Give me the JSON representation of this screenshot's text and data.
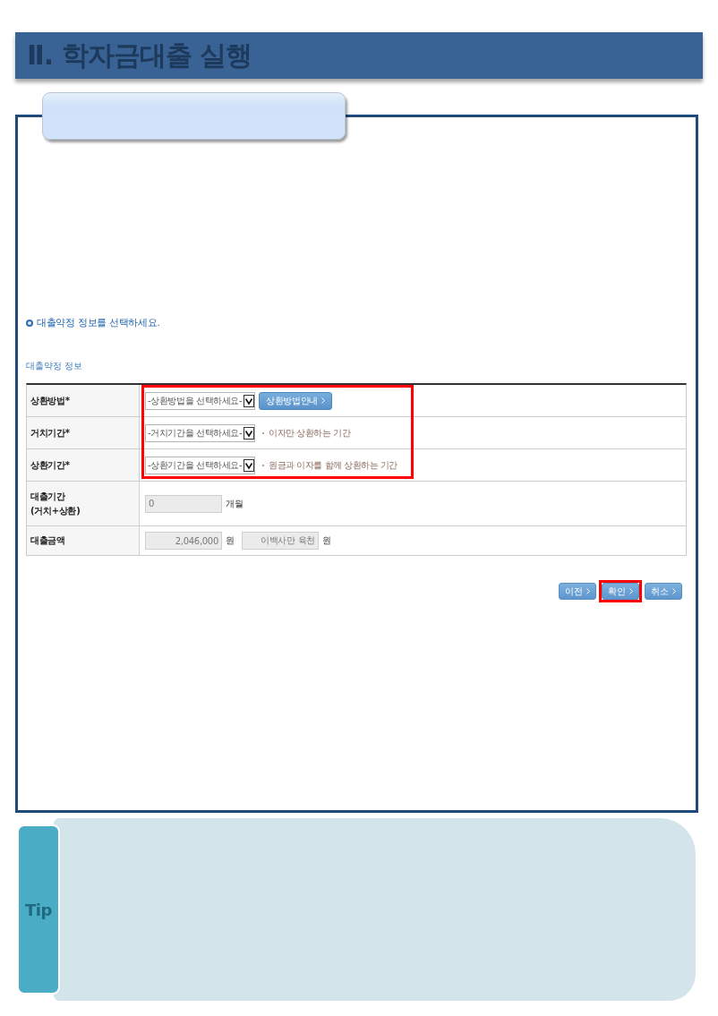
{
  "header": {
    "title": "Ⅱ. 학자금대출 실행"
  },
  "instruction": "대출약정 정보를 선택하세요.",
  "section_title": "대출약정 정보",
  "loan_terms": {
    "rows": [
      {
        "kind": "select",
        "label": "상환방법*",
        "select": "-상환방법을 선택하세요-",
        "button": "상환방법안내",
        "highlighted": true
      },
      {
        "kind": "select",
        "label": "거치기간*",
        "select": "-거치기간을 선택하세요-",
        "hint": "이자만 상환하는 기간",
        "highlighted": true
      },
      {
        "kind": "select",
        "label": "상환기간*",
        "select": "-상환기간을 선택하세요-",
        "hint": "원금과 이자를 함께 상환하는 기간",
        "highlighted": true
      },
      {
        "kind": "period",
        "label": "대출기간\n(거치+상환)",
        "fields": [
          {
            "value": "0",
            "unit": "개월"
          }
        ],
        "highlighted": false
      },
      {
        "kind": "amount",
        "label": "대출금액",
        "fields": [
          {
            "value": "2,046,000",
            "unit": "원"
          },
          {
            "value": "이백사만 육천",
            "unit": "원"
          }
        ],
        "highlighted": false
      }
    ]
  },
  "buttons": [
    {
      "label": "이전",
      "highlighted": false
    },
    {
      "label": "확인",
      "highlighted": true
    },
    {
      "label": "취소",
      "highlighted": false
    }
  ],
  "tip": {
    "label": "Tip"
  }
}
